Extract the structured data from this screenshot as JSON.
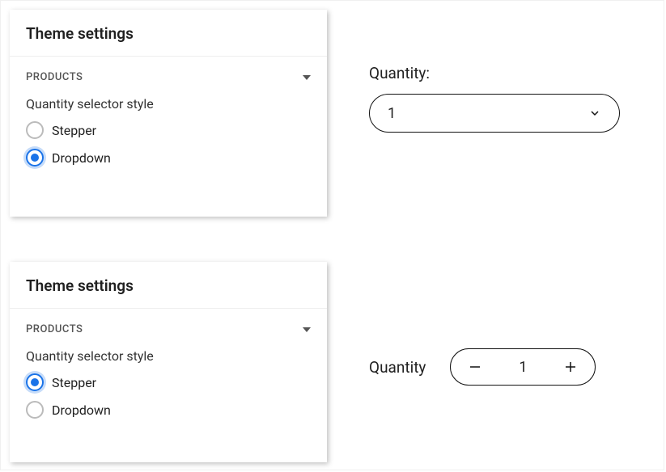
{
  "panel1": {
    "title": "Theme settings",
    "section_label": "PRODUCTS",
    "setting_label": "Quantity selector style",
    "options": {
      "stepper": "Stepper",
      "dropdown": "Dropdown"
    },
    "selected": "dropdown"
  },
  "panel2": {
    "title": "Theme settings",
    "section_label": "PRODUCTS",
    "setting_label": "Quantity selector style",
    "options": {
      "stepper": "Stepper",
      "dropdown": "Dropdown"
    },
    "selected": "stepper"
  },
  "preview1": {
    "label": "Quantity:",
    "value": "1"
  },
  "preview2": {
    "label": "Quantity",
    "value": "1"
  },
  "colors": {
    "accent": "#1a73e8"
  }
}
